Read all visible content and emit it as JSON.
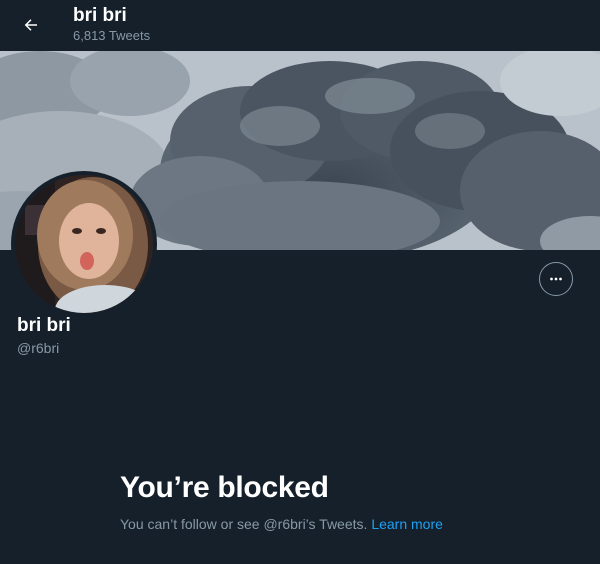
{
  "header": {
    "title": "bri bri",
    "tweet_count": "6,813 Tweets"
  },
  "profile": {
    "display_name": "bri bri",
    "handle": "@r6bri"
  },
  "blocked": {
    "title": "You’re blocked",
    "message": "You can’t follow or see @r6bri’s Tweets.",
    "link_label": "Learn more"
  },
  "icons": {
    "back": "arrow-left-icon",
    "more": "more-horizontal-icon"
  },
  "colors": {
    "background": "#15202b",
    "text_primary": "#ffffff",
    "text_secondary": "#8899a6",
    "accent": "#1da1f2"
  }
}
